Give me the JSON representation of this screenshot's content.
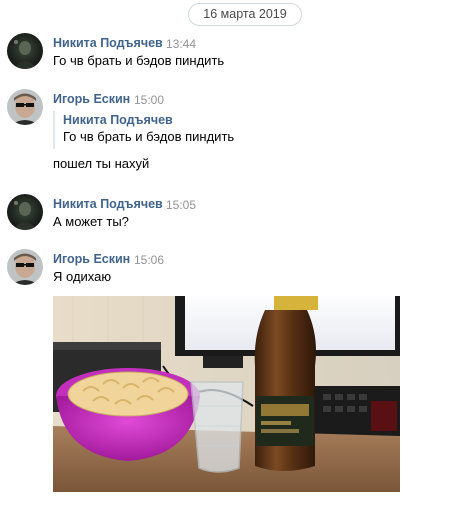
{
  "date_label": "16 марта 2019",
  "messages": [
    {
      "author": "Никита Подъячев",
      "time": "13:44",
      "text": "Го чв брать и бэдов пиндить"
    },
    {
      "author": "Игорь Ескин",
      "time": "15:00",
      "quote": {
        "author": "Никита Подъячев",
        "text": "Го чв брать и бэдов пиндить"
      },
      "text": "пошел ты нахуй"
    },
    {
      "author": "Никита Подъячев",
      "time": "15:05",
      "text": "А может ты?"
    },
    {
      "author": "Игорь Ескин",
      "time": "15:06",
      "text": "Я одихаю",
      "attachment": "photo"
    }
  ],
  "icons": {
    "avatar_nikita": "avatar-dark-photo",
    "avatar_igor": "avatar-sunglasses-photo"
  },
  "colors": {
    "author_name": "#42648b",
    "time": "#939393",
    "quote_border": "#dfe6ed",
    "date_border": "#d3d9de"
  }
}
